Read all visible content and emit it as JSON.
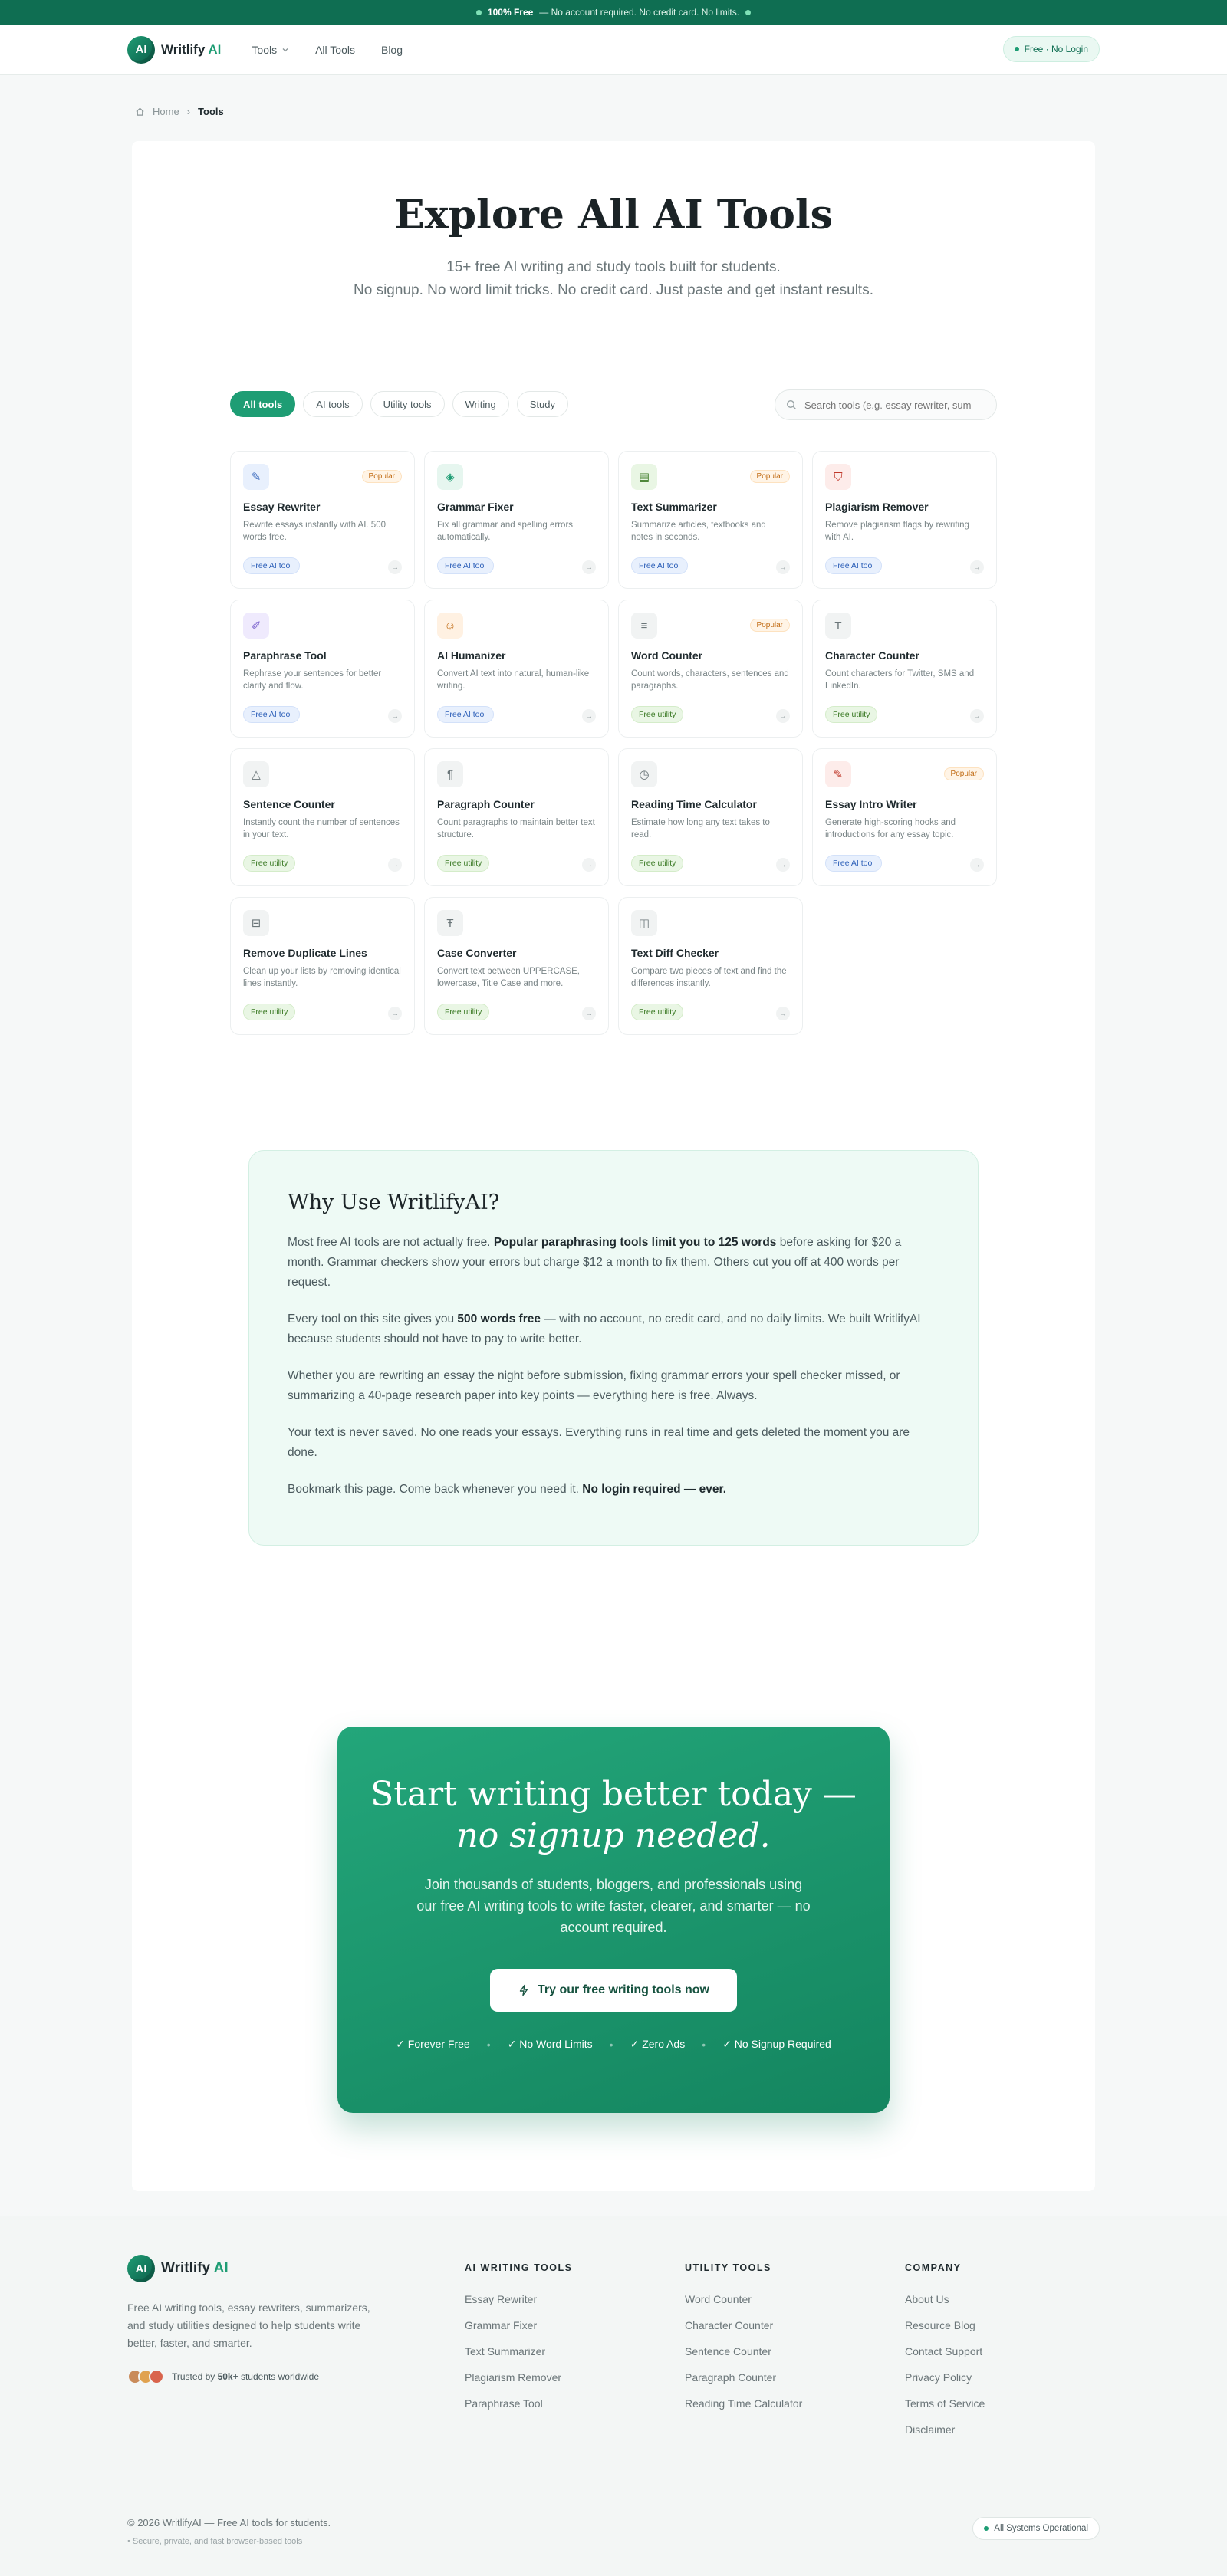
{
  "banner": {
    "highlight": "100% Free",
    "text": "— No account required. No credit card. No limits."
  },
  "nav": {
    "logo_mark": "AI",
    "brand": "Writlify",
    "brand_suffix": "AI",
    "links": [
      "Tools",
      "All Tools",
      "Blog"
    ],
    "badge": "Free · No Login"
  },
  "breadcrumb": {
    "home": "Home",
    "current": "Tools"
  },
  "hero": {
    "title": "Explore All AI Tools",
    "subtitle_1": "15+ free AI writing and study tools built for students.",
    "subtitle_2": "No signup. No word limit tricks. No credit card. Just paste and get instant results."
  },
  "filters": [
    "All tools",
    "AI tools",
    "Utility tools",
    "Writing",
    "Study"
  ],
  "search": {
    "placeholder": "Search tools (e.g. essay rewriter, sum"
  },
  "tools": [
    {
      "title": "Essay Rewriter",
      "desc": "Rewrite essays instantly with AI. 500 words free.",
      "tag": "Free AI tool",
      "kind": "ai",
      "popular": "Popular",
      "icon": "✎",
      "bg": "#e8f0fd",
      "fg": "#2c5fb8"
    },
    {
      "title": "Grammar Fixer",
      "desc": "Fix all grammar and spelling errors automatically.",
      "tag": "Free AI tool",
      "kind": "ai",
      "popular": "",
      "icon": "◈",
      "bg": "#e6f6ef",
      "fg": "#1e9d74"
    },
    {
      "title": "Text Summarizer",
      "desc": "Summarize articles, textbooks and notes in seconds.",
      "tag": "Free AI tool",
      "kind": "ai",
      "popular": "Popular",
      "icon": "▤",
      "bg": "#e9f6e4",
      "fg": "#3b7a25"
    },
    {
      "title": "Plagiarism Remover",
      "desc": "Remove plagiarism flags by rewriting with AI.",
      "tag": "Free AI tool",
      "kind": "ai",
      "popular": "",
      "icon": "⛉",
      "bg": "#fdecea",
      "fg": "#c0392b"
    },
    {
      "title": "Paraphrase Tool",
      "desc": "Rephrase your sentences for better clarity and flow.",
      "tag": "Free AI tool",
      "kind": "ai",
      "popular": "",
      "icon": "✐",
      "bg": "#efeafd",
      "fg": "#6a4fc6"
    },
    {
      "title": "AI Humanizer",
      "desc": "Convert AI text into natural, human-like writing.",
      "tag": "Free AI tool",
      "kind": "ai",
      "popular": "",
      "icon": "☺",
      "bg": "#fff1e2",
      "fg": "#c06a12"
    },
    {
      "title": "Word Counter",
      "desc": "Count words, characters, sentences and paragraphs.",
      "tag": "Free utility",
      "kind": "ut",
      "popular": "Popular",
      "icon": "≡",
      "bg": "#f1f3f3",
      "fg": "#6b7679"
    },
    {
      "title": "Character Counter",
      "desc": "Count characters for Twitter, SMS and LinkedIn.",
      "tag": "Free utility",
      "kind": "ut",
      "popular": "",
      "icon": "T",
      "bg": "#f1f3f3",
      "fg": "#6b7679"
    },
    {
      "title": "Sentence Counter",
      "desc": "Instantly count the number of sentences in your text.",
      "tag": "Free utility",
      "kind": "ut",
      "popular": "",
      "icon": "△",
      "bg": "#f1f3f3",
      "fg": "#6b7679"
    },
    {
      "title": "Paragraph Counter",
      "desc": "Count paragraphs to maintain better text structure.",
      "tag": "Free utility",
      "kind": "ut",
      "popular": "",
      "icon": "¶",
      "bg": "#f1f3f3",
      "fg": "#6b7679"
    },
    {
      "title": "Reading Time Calculator",
      "desc": "Estimate how long any text takes to read.",
      "tag": "Free utility",
      "kind": "ut",
      "popular": "",
      "icon": "◷",
      "bg": "#f1f3f3",
      "fg": "#6b7679"
    },
    {
      "title": "Essay Intro Writer",
      "desc": "Generate high-scoring hooks and introductions for any essay topic.",
      "tag": "Free AI tool",
      "kind": "ai",
      "popular": "Popular",
      "icon": "✎",
      "bg": "#fdecea",
      "fg": "#c0392b"
    },
    {
      "title": "Remove Duplicate Lines",
      "desc": "Clean up your lists by removing identical lines instantly.",
      "tag": "Free utility",
      "kind": "ut",
      "popular": "",
      "icon": "⊟",
      "bg": "#f1f3f3",
      "fg": "#6b7679"
    },
    {
      "title": "Case Converter",
      "desc": "Convert text between UPPERCASE, lowercase, Title Case and more.",
      "tag": "Free utility",
      "kind": "ut",
      "popular": "",
      "icon": "Ŧ",
      "bg": "#f1f3f3",
      "fg": "#6b7679"
    },
    {
      "title": "Text Diff Checker",
      "desc": "Compare two pieces of text and find the differences instantly.",
      "tag": "Free utility",
      "kind": "ut",
      "popular": "",
      "icon": "◫",
      "bg": "#f1f3f3",
      "fg": "#6b7679"
    }
  ],
  "why": {
    "title": "Why Use WritlifyAI?",
    "p1_a": "Most free AI tools are not actually free. ",
    "p1_b": "Popular paraphrasing tools limit you to 125 words",
    "p1_c": " before asking for $20 a month. Grammar checkers show your errors but charge $12 a month to fix them. Others cut you off at 400 words per request.",
    "p2_a": "Every tool on this site gives you ",
    "p2_b": "500 words free",
    "p2_c": " — with no account, no credit card, and no daily limits. We built WritlifyAI because students should not have to pay to write better.",
    "p3": "Whether you are rewriting an essay the night before submission, fixing grammar errors your spell checker missed, or summarizing a 40-page research paper into key points — everything here is free. Always.",
    "p4": "Your text is never saved. No one reads your essays. Everything runs in real time and gets deleted the moment you are done.",
    "p5_a": "Bookmark this page. Come back whenever you need it. ",
    "p5_b": "No login required — ever."
  },
  "cta": {
    "title_1": "Start writing better today —",
    "title_2": "no signup needed.",
    "body": "Join thousands of students, bloggers, and professionals using our free AI writing tools to write faster, clearer, and smarter — no account required.",
    "button": "Try our free writing tools now",
    "features": [
      "Forever Free",
      "No Word Limits",
      "Zero Ads",
      "No Signup Required"
    ]
  },
  "footer": {
    "brand": "Writlify",
    "brand_suffix": "AI",
    "description": "Free AI writing tools, essay rewriters, summarizers, and study utilities designed to help students write better, faster, and smarter.",
    "trust_prefix": "Trusted by ",
    "trust_count": "50k+",
    "trust_suffix": " students worldwide",
    "columns": [
      {
        "title": "AI WRITING TOOLS",
        "links": [
          "Essay Rewriter",
          "Grammar Fixer",
          "Text Summarizer",
          "Plagiarism Remover",
          "Paraphrase Tool"
        ]
      },
      {
        "title": "UTILITY TOOLS",
        "links": [
          "Word Counter",
          "Character Counter",
          "Sentence Counter",
          "Paragraph Counter",
          "Reading Time Calculator"
        ]
      },
      {
        "title": "COMPANY",
        "links": [
          "About Us",
          "Resource Blog",
          "Contact Support",
          "Privacy Policy",
          "Terms of Service",
          "Disclaimer"
        ]
      }
    ],
    "copyright": "© 2026 WritlifyAI — Free AI tools for students.",
    "secure": "• Secure, private, and fast browser-based tools",
    "status": "All Systems Operational"
  },
  "colors": {
    "accent": "#1e9d74",
    "accent_dark": "#0f6e52",
    "banner": "#0f6e52"
  }
}
